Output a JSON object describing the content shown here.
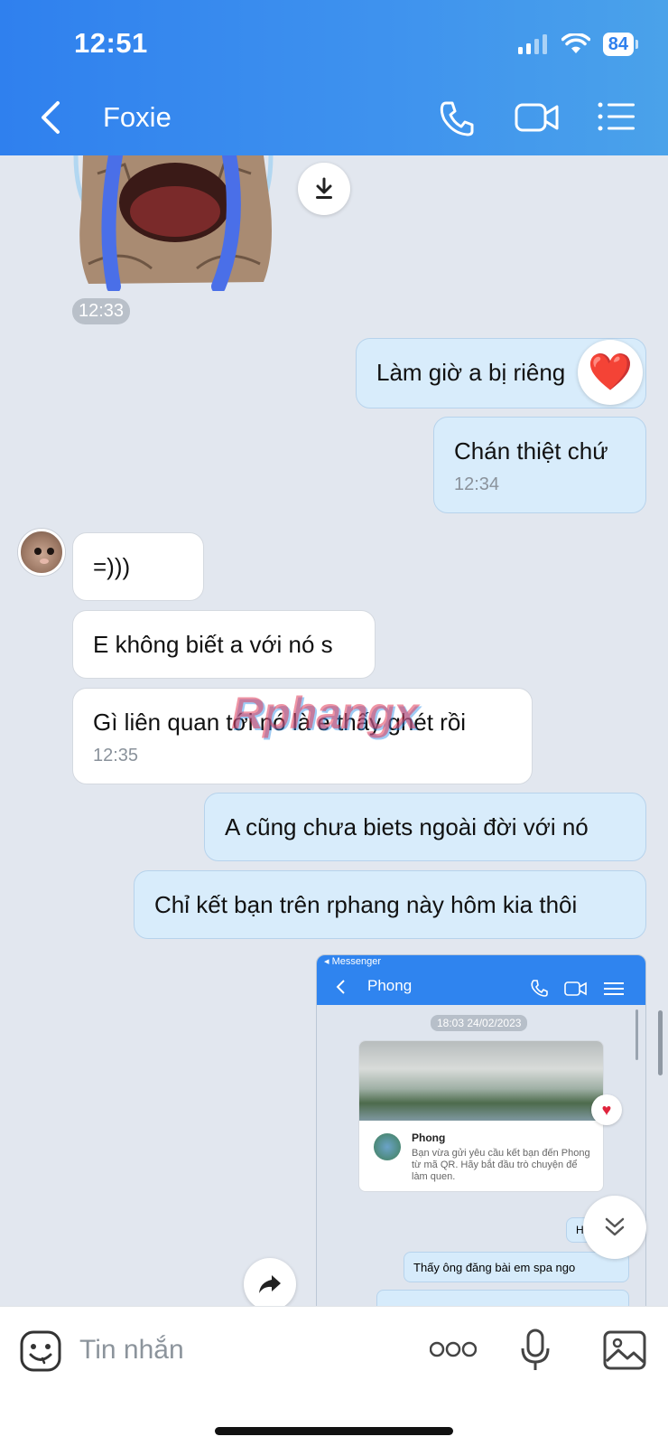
{
  "status_bar": {
    "time": "12:51",
    "battery": "84"
  },
  "header": {
    "contact_name": "Foxie"
  },
  "messages": [
    {
      "id": "m1",
      "side": "in",
      "type": "sticker",
      "time": "12:33"
    },
    {
      "id": "m2",
      "side": "out",
      "text": "Làm giờ a bị riêng",
      "reaction": "❤️"
    },
    {
      "id": "m3",
      "side": "out",
      "text": "Chán thiệt chứ",
      "time": "12:34"
    },
    {
      "id": "m4",
      "side": "in",
      "text": "=)))"
    },
    {
      "id": "m5",
      "side": "in",
      "text": "E không biết a với nó s"
    },
    {
      "id": "m6",
      "side": "in",
      "text": "Gì liên quan tới nó là e thấy ghét rồi",
      "time": "12:35"
    },
    {
      "id": "m7",
      "side": "out",
      "text": "A cũng chưa biets ngoài đời với nó"
    },
    {
      "id": "m8",
      "side": "out",
      "text": "Chỉ kết bạn trên rphang này hôm kia thôi"
    },
    {
      "id": "m9",
      "side": "out",
      "type": "image"
    }
  ],
  "watermark": "Rphangx",
  "inner_screenshot": {
    "status_label": "◂ Messenger",
    "contact_name": "Phong",
    "date": "18:03 24/02/2023",
    "card_name": "Phong",
    "card_desc": "Bạn vừa gửi yêu cầu kết bạn đến Phong từ mã QR. Hãy bắt đầu trò chuyện để làm quen.",
    "bubble_1": "Hi",
    "bubble_2": "Thấy ông đăng bài em spa ngo"
  },
  "composer": {
    "placeholder": "Tin nhắn"
  },
  "colors": {
    "header": "#2f80ee",
    "bubble_out": "#d8ecfb",
    "bubble_in": "#ffffff",
    "chat_bg": "#e2e7ef"
  },
  "icons": [
    "back-icon",
    "phone-icon",
    "video-icon",
    "list-icon",
    "download-icon",
    "share-icon",
    "scroll-down-icon",
    "emoji-icon",
    "more-icon",
    "mic-icon",
    "image-icon"
  ]
}
